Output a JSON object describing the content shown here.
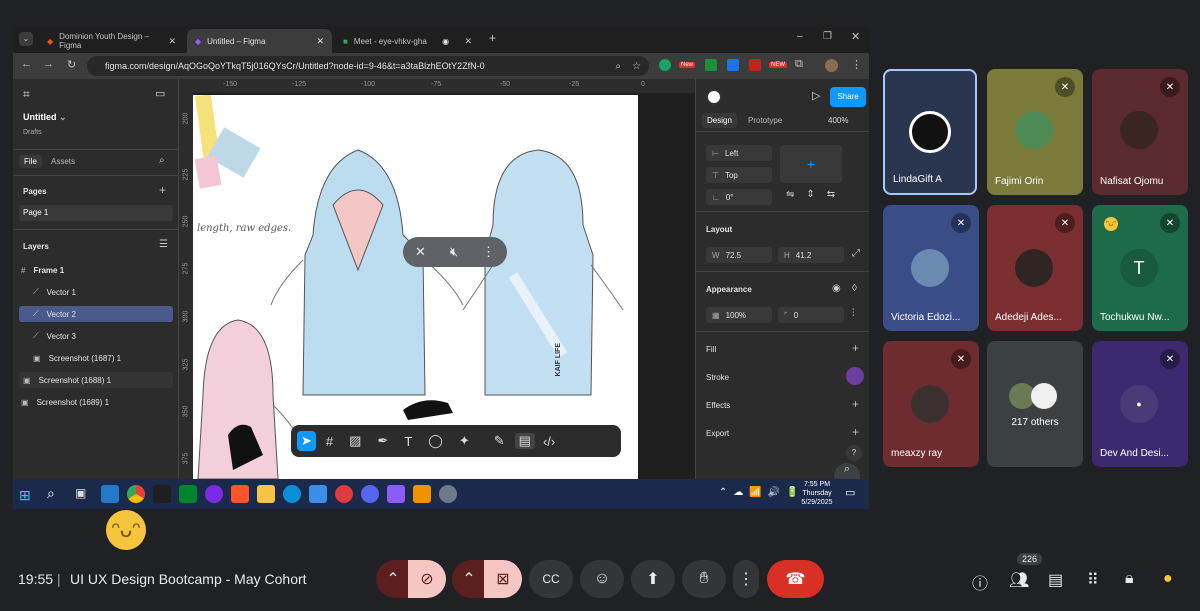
{
  "browser": {
    "tabs": [
      {
        "label": "Dominion Youth Design – Figma"
      },
      {
        "label": "Untitled – Figma"
      },
      {
        "label": "Meet - eye-vhkv-gha"
      }
    ],
    "url": "figma.com/design/AqOGoQoYTkqT5j016QYsCr/Untitled?node-id=9-46&t=a3taBlzhEOtY2ZfN-0",
    "new_badge": "New",
    "new_badge2": "NEW"
  },
  "figma": {
    "file_title": "Untitled",
    "drafts": "Drafts",
    "file_tab": "File",
    "assets_tab": "Assets",
    "pages_label": "Pages",
    "page1": "Page 1",
    "layers_label": "Layers",
    "layers": [
      {
        "label": "Frame 1"
      },
      {
        "label": "Vector 1"
      },
      {
        "label": "Vector 2"
      },
      {
        "label": "Vector 3"
      },
      {
        "label": "Screenshot (1687) 1"
      },
      {
        "label": "Screenshot (1688) 1"
      },
      {
        "label": "Screenshot (1689) 1"
      }
    ],
    "ruler": [
      "-150",
      "-125",
      "-100",
      "-75",
      "-50",
      "-25",
      "0"
    ],
    "ruler_v": [
      "200",
      "225",
      "250",
      "275",
      "300",
      "325",
      "350",
      "375"
    ],
    "canvas_text": "length, raw edges.",
    "shirt_label": "KAIF LIFE",
    "share_button": "Share",
    "design_tab": "Design",
    "prototype_tab": "Prototype",
    "zoom": "400%",
    "align_left": "Left",
    "align_top": "Top",
    "rotation": "0°",
    "layout_label": "Layout",
    "w_label": "W",
    "w_value": "72.5",
    "h_label": "H",
    "h_value": "41.2",
    "appearance_label": "Appearance",
    "opacity": "100%",
    "radius": "0",
    "fill_label": "Fill",
    "stroke_label": "Stroke",
    "effects_label": "Effects",
    "export_label": "Export",
    "help": "?"
  },
  "taskbar": {
    "time": "7:55 PM",
    "day": "Thursday",
    "date": "5/29/2025"
  },
  "meet": {
    "participants": [
      {
        "name": "LindaGift A"
      },
      {
        "name": "Fajimi Orin"
      },
      {
        "name": "Nafisat Ojomu"
      },
      {
        "name": "Victoria Edozi..."
      },
      {
        "name": "Adedeji Ades..."
      },
      {
        "name": "Tochukwu Nw..."
      },
      {
        "name": "meaxzy ray"
      },
      {
        "name": "217 others"
      },
      {
        "name": "Dev And Desi..."
      }
    ],
    "initial_t": "T",
    "clock": "19:55",
    "separator": "|",
    "meeting_title": "UI UX Design Bootcamp - May Cohort",
    "people_count": "226"
  }
}
